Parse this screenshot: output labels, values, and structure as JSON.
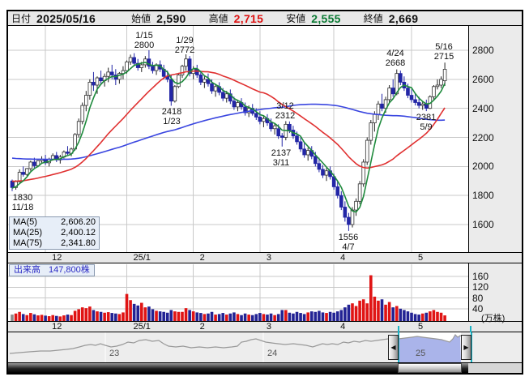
{
  "header": {
    "date_label": "日付",
    "date_value": "2025/05/16",
    "open_label": "始値",
    "open_value": "2,590",
    "high_label": "高値",
    "high_value": "2,715",
    "low_label": "安値",
    "low_value": "2,555",
    "close_label": "終値",
    "close_value": "2,669"
  },
  "ma_legend": {
    "rows": [
      {
        "label": "MA(5)",
        "value": "2,606.20",
        "color": "#1e8a3c"
      },
      {
        "label": "MA(25)",
        "value": "2,400.12",
        "color": "#e03030"
      },
      {
        "label": "MA(75)",
        "value": "2,341.80",
        "color": "#3a46e0"
      }
    ]
  },
  "volume_label": {
    "label": "出来高",
    "value": "147,800株"
  },
  "colors": {
    "up_candle": "#ffffff",
    "up_stroke": "#333333",
    "down_candle": "#2326a6",
    "down_stroke": "#2326a6",
    "ma5": "#1e8a3c",
    "ma25": "#e03030",
    "ma75": "#3a46e0",
    "vol_up": "#e01414",
    "vol_down": "#232394",
    "vol_first": "#8a8a8a",
    "grid": "#c9c9c9",
    "panel_bg": "#e8e8e8",
    "nav_line": "#999999",
    "nav_fill": "#aab4ea",
    "cyan": "#1ab2c4"
  },
  "chart_data": {
    "type": "candlestick+volume",
    "price_axis": {
      "ticks": [
        2800,
        2600,
        2400,
        2200,
        2000,
        1800,
        1600
      ],
      "ylim": [
        1520,
        2980
      ]
    },
    "volume_axis": {
      "ticks": [
        160,
        120,
        80,
        40
      ],
      "unit": "(万株)",
      "scale": "万株"
    },
    "x_axis": {
      "month_labels": [
        "12",
        "25/1",
        "2",
        "3",
        "4",
        "5"
      ],
      "month_start_indices": [
        9,
        31,
        49,
        67,
        87,
        108
      ]
    },
    "annotations": [
      {
        "x": 28,
        "y": 238,
        "lines": [
          "1830",
          "11/18"
        ]
      },
      {
        "x": 178,
        "y": 38,
        "lines": [
          "1/15",
          "2800"
        ]
      },
      {
        "x": 228,
        "y": 44,
        "lines": [
          "1/29",
          "2772"
        ]
      },
      {
        "x": 212,
        "y": 132,
        "lines": [
          "2418",
          "1/23"
        ]
      },
      {
        "x": 352,
        "y": 125,
        "lines": [
          "3/12",
          "2312"
        ]
      },
      {
        "x": 347,
        "y": 183,
        "lines": [
          "2137",
          "3/11"
        ]
      },
      {
        "x": 430,
        "y": 287,
        "lines": [
          "1556",
          "4/7"
        ]
      },
      {
        "x": 488,
        "y": 60,
        "lines": [
          "4/24",
          "2668"
        ]
      },
      {
        "x": 548,
        "y": 52,
        "lines": [
          "5/16",
          "2715"
        ]
      },
      {
        "x": 526,
        "y": 139,
        "lines": [
          "2381",
          "5/9"
        ]
      }
    ],
    "candles": [
      [
        1900,
        1910,
        1830,
        1855
      ],
      [
        1855,
        1905,
        1840,
        1895
      ],
      [
        1895,
        1980,
        1890,
        1960
      ],
      [
        1960,
        2000,
        1930,
        1945
      ],
      [
        1945,
        1990,
        1935,
        1985
      ],
      [
        1985,
        2040,
        1970,
        2030
      ],
      [
        2030,
        2060,
        1990,
        2005
      ],
      [
        2005,
        2045,
        1995,
        2040
      ],
      [
        2040,
        2070,
        2020,
        2050
      ],
      [
        2050,
        2080,
        2010,
        2025
      ],
      [
        2025,
        2060,
        2000,
        2050
      ],
      [
        2050,
        2090,
        2040,
        2075
      ],
      [
        2075,
        2100,
        2030,
        2045
      ],
      [
        2045,
        2080,
        2020,
        2065
      ],
      [
        2065,
        2110,
        2055,
        2100
      ],
      [
        2100,
        2140,
        2080,
        2090
      ],
      [
        2090,
        2130,
        2070,
        2120
      ],
      [
        2120,
        2230,
        2110,
        2220
      ],
      [
        2220,
        2330,
        2200,
        2310
      ],
      [
        2310,
        2440,
        2290,
        2420
      ],
      [
        2420,
        2520,
        2380,
        2490
      ],
      [
        2490,
        2600,
        2460,
        2580
      ],
      [
        2580,
        2650,
        2520,
        2560
      ],
      [
        2560,
        2620,
        2500,
        2610
      ],
      [
        2610,
        2660,
        2560,
        2590
      ],
      [
        2590,
        2640,
        2550,
        2620
      ],
      [
        2620,
        2680,
        2580,
        2650
      ],
      [
        2650,
        2700,
        2600,
        2630
      ],
      [
        2630,
        2670,
        2560,
        2600
      ],
      [
        2600,
        2650,
        2570,
        2640
      ],
      [
        2640,
        2690,
        2600,
        2660
      ],
      [
        2660,
        2730,
        2640,
        2720
      ],
      [
        2720,
        2770,
        2700,
        2750
      ],
      [
        2750,
        2780,
        2690,
        2710
      ],
      [
        2710,
        2740,
        2660,
        2680
      ],
      [
        2680,
        2720,
        2650,
        2700
      ],
      [
        2700,
        2760,
        2680,
        2740
      ],
      [
        2740,
        2800,
        2670,
        2690
      ],
      [
        2690,
        2720,
        2640,
        2660
      ],
      [
        2660,
        2710,
        2630,
        2700
      ],
      [
        2700,
        2730,
        2650,
        2670
      ],
      [
        2670,
        2700,
        2600,
        2620
      ],
      [
        2620,
        2660,
        2580,
        2600
      ],
      [
        2600,
        2630,
        2418,
        2450
      ],
      [
        2450,
        2560,
        2440,
        2550
      ],
      [
        2550,
        2640,
        2540,
        2630
      ],
      [
        2630,
        2700,
        2610,
        2690
      ],
      [
        2690,
        2772,
        2660,
        2740
      ],
      [
        2740,
        2760,
        2620,
        2640
      ],
      [
        2640,
        2690,
        2600,
        2670
      ],
      [
        2670,
        2700,
        2610,
        2630
      ],
      [
        2630,
        2660,
        2560,
        2580
      ],
      [
        2580,
        2620,
        2540,
        2600
      ],
      [
        2600,
        2640,
        2550,
        2570
      ],
      [
        2570,
        2600,
        2500,
        2520
      ],
      [
        2520,
        2570,
        2480,
        2550
      ],
      [
        2550,
        2580,
        2490,
        2510
      ],
      [
        2510,
        2540,
        2450,
        2470
      ],
      [
        2470,
        2520,
        2440,
        2500
      ],
      [
        2500,
        2530,
        2430,
        2450
      ],
      [
        2450,
        2480,
        2390,
        2410
      ],
      [
        2410,
        2460,
        2380,
        2440
      ],
      [
        2440,
        2470,
        2390,
        2410
      ],
      [
        2410,
        2440,
        2350,
        2370
      ],
      [
        2370,
        2420,
        2340,
        2400
      ],
      [
        2400,
        2430,
        2350,
        2365
      ],
      [
        2365,
        2400,
        2320,
        2340
      ],
      [
        2340,
        2380,
        2290,
        2310
      ],
      [
        2310,
        2350,
        2270,
        2330
      ],
      [
        2330,
        2360,
        2280,
        2300
      ],
      [
        2300,
        2330,
        2240,
        2260
      ],
      [
        2260,
        2300,
        2220,
        2280
      ],
      [
        2260,
        2290,
        2190,
        2210
      ],
      [
        2210,
        2230,
        2137,
        2200
      ],
      [
        2200,
        2312,
        2180,
        2290
      ],
      [
        2290,
        2310,
        2230,
        2250
      ],
      [
        2250,
        2280,
        2190,
        2210
      ],
      [
        2210,
        2240,
        2150,
        2170
      ],
      [
        2170,
        2200,
        2100,
        2120
      ],
      [
        2120,
        2160,
        2060,
        2080
      ],
      [
        2080,
        2130,
        2040,
        2110
      ],
      [
        2110,
        2140,
        2050,
        2070
      ],
      [
        2070,
        2100,
        2000,
        2020
      ],
      [
        2020,
        2060,
        1960,
        1980
      ],
      [
        1980,
        2010,
        1920,
        1940
      ],
      [
        1940,
        1990,
        1900,
        1970
      ],
      [
        1970,
        2000,
        1910,
        1930
      ],
      [
        1930,
        1950,
        1840,
        1860
      ],
      [
        1860,
        1900,
        1780,
        1800
      ],
      [
        1800,
        1830,
        1700,
        1720
      ],
      [
        1720,
        1760,
        1620,
        1650
      ],
      [
        1650,
        1680,
        1556,
        1600
      ],
      [
        1600,
        1720,
        1580,
        1700
      ],
      [
        1700,
        1780,
        1660,
        1760
      ],
      [
        1760,
        1900,
        1740,
        1880
      ],
      [
        1880,
        2050,
        1860,
        2030
      ],
      [
        2030,
        2200,
        2010,
        2180
      ],
      [
        2180,
        2320,
        2150,
        2300
      ],
      [
        2300,
        2380,
        2240,
        2360
      ],
      [
        2360,
        2450,
        2320,
        2430
      ],
      [
        2430,
        2500,
        2380,
        2400
      ],
      [
        2400,
        2480,
        2370,
        2460
      ],
      [
        2460,
        2560,
        2440,
        2540
      ],
      [
        2540,
        2600,
        2480,
        2500
      ],
      [
        2500,
        2668,
        2490,
        2640
      ],
      [
        2640,
        2660,
        2560,
        2580
      ],
      [
        2580,
        2620,
        2520,
        2540
      ],
      [
        2540,
        2570,
        2470,
        2490
      ],
      [
        2490,
        2530,
        2440,
        2460
      ],
      [
        2460,
        2500,
        2420,
        2440
      ],
      [
        2440,
        2480,
        2400,
        2420
      ],
      [
        2420,
        2450,
        2390,
        2430
      ],
      [
        2430,
        2460,
        2381,
        2400
      ],
      [
        2400,
        2490,
        2395,
        2480
      ],
      [
        2480,
        2560,
        2460,
        2550
      ],
      [
        2550,
        2600,
        2530,
        2560
      ],
      [
        2560,
        2620,
        2540,
        2600
      ],
      [
        2590,
        2715,
        2555,
        2669
      ]
    ],
    "volumes": [
      18,
      22,
      28,
      20,
      16,
      24,
      19,
      15,
      17,
      14,
      12,
      16,
      13,
      11,
      15,
      18,
      16,
      32,
      38,
      45,
      42,
      48,
      35,
      30,
      28,
      25,
      27,
      24,
      22,
      20,
      26,
      95,
      72,
      58,
      52,
      62,
      45,
      48,
      38,
      32,
      30,
      28,
      25,
      35,
      30,
      28,
      28,
      42,
      35,
      30,
      26,
      24,
      20,
      22,
      28,
      18,
      20,
      24,
      18,
      22,
      26,
      20,
      16,
      22,
      18,
      16,
      20,
      24,
      20,
      18,
      22,
      16,
      20,
      35,
      35,
      25,
      22,
      28,
      24,
      20,
      26,
      30,
      28,
      32,
      26,
      24,
      28,
      25,
      30,
      35,
      45,
      55,
      60,
      50,
      70,
      75,
      60,
      165,
      85,
      70,
      75,
      55,
      65,
      45,
      50,
      40,
      35,
      30,
      25,
      20,
      18,
      22,
      25,
      30,
      35,
      28,
      25,
      15
    ],
    "navigator": {
      "years": [
        "23",
        "24",
        "25"
      ],
      "year_x": [
        125,
        320,
        503
      ],
      "selection": [
        482,
        559
      ],
      "points": [
        [
          2,
          26
        ],
        [
          14,
          25
        ],
        [
          26,
          24
        ],
        [
          40,
          23
        ],
        [
          52,
          23
        ],
        [
          62,
          22
        ],
        [
          72,
          21
        ],
        [
          80,
          20
        ],
        [
          88,
          18
        ],
        [
          95,
          16
        ],
        [
          102,
          15
        ],
        [
          108,
          16
        ],
        [
          114,
          14
        ],
        [
          120,
          16
        ],
        [
          127,
          18
        ],
        [
          134,
          17
        ],
        [
          141,
          15
        ],
        [
          148,
          12
        ],
        [
          155,
          13
        ],
        [
          162,
          10
        ],
        [
          170,
          9
        ],
        [
          178,
          11
        ],
        [
          186,
          10
        ],
        [
          192,
          14
        ],
        [
          198,
          17
        ],
        [
          207,
          18
        ],
        [
          216,
          17
        ],
        [
          226,
          19
        ],
        [
          236,
          18
        ],
        [
          246,
          19
        ],
        [
          256,
          18
        ],
        [
          266,
          19
        ],
        [
          276,
          18
        ],
        [
          283,
          17
        ],
        [
          288,
          12
        ],
        [
          294,
          11
        ],
        [
          300,
          9
        ],
        [
          306,
          8
        ],
        [
          312,
          10
        ],
        [
          318,
          12
        ],
        [
          325,
          13
        ],
        [
          333,
          14
        ],
        [
          342,
          15
        ],
        [
          352,
          14
        ],
        [
          360,
          15
        ],
        [
          368,
          16
        ],
        [
          376,
          18
        ],
        [
          382,
          16
        ],
        [
          388,
          14
        ],
        [
          394,
          15
        ],
        [
          400,
          14
        ],
        [
          407,
          15
        ],
        [
          414,
          12
        ],
        [
          420,
          13
        ],
        [
          427,
          11
        ],
        [
          434,
          12
        ],
        [
          441,
          10
        ],
        [
          448,
          11
        ],
        [
          455,
          10
        ],
        [
          462,
          9
        ],
        [
          469,
          8
        ],
        [
          476,
          8
        ],
        [
          482,
          8
        ],
        [
          490,
          7
        ],
        [
          498,
          6
        ],
        [
          505,
          5
        ],
        [
          512,
          6
        ],
        [
          520,
          7
        ],
        [
          528,
          8
        ],
        [
          535,
          9
        ],
        [
          545,
          12
        ],
        [
          549,
          8
        ],
        [
          552,
          3
        ],
        [
          555,
          6
        ],
        [
          558,
          4
        ],
        [
          560,
          5
        ]
      ]
    }
  }
}
